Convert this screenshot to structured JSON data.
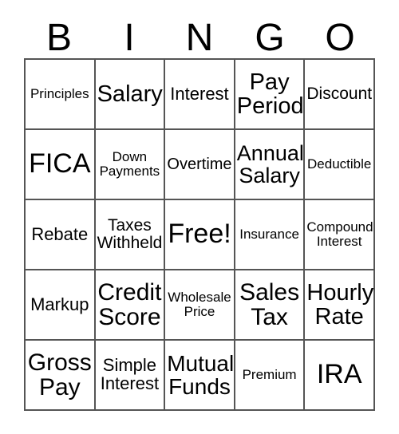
{
  "card": {
    "title_letters": [
      "B",
      "I",
      "N",
      "G",
      "O"
    ],
    "grid": {
      "columns": 5,
      "rows": 5,
      "border_color": "#555555",
      "background_color": "#ffffff",
      "text_color": "#000000"
    },
    "cells": [
      {
        "text": "Principles",
        "size": "sm",
        "row": 1,
        "col": 1
      },
      {
        "text": "Salary",
        "size": "xl",
        "row": 1,
        "col": 2
      },
      {
        "text": "Interest",
        "size": "md",
        "row": 1,
        "col": 3
      },
      {
        "text": "Pay Period",
        "size": "xl",
        "row": 1,
        "col": 4
      },
      {
        "text": "Discount",
        "size": "md",
        "row": 1,
        "col": 5
      },
      {
        "text": "FICA",
        "size": "xxl",
        "row": 2,
        "col": 1
      },
      {
        "text": "Down Payments",
        "size": "sm",
        "row": 2,
        "col": 2
      },
      {
        "text": "Overtime",
        "size": "md",
        "row": 2,
        "col": 3
      },
      {
        "text": "Annual Salary",
        "size": "lg",
        "row": 2,
        "col": 4
      },
      {
        "text": "Deductible",
        "size": "sm",
        "row": 2,
        "col": 5
      },
      {
        "text": "Rebate",
        "size": "md",
        "row": 3,
        "col": 1
      },
      {
        "text": "Taxes Withheld",
        "size": "md",
        "row": 3,
        "col": 2
      },
      {
        "text": "Free!",
        "size": "xxl",
        "row": 3,
        "col": 3
      },
      {
        "text": "Insurance",
        "size": "sm",
        "row": 3,
        "col": 4
      },
      {
        "text": "Compound Interest",
        "size": "sm",
        "row": 3,
        "col": 5
      },
      {
        "text": "Markup",
        "size": "md",
        "row": 4,
        "col": 1
      },
      {
        "text": "Credit Score",
        "size": "xl",
        "row": 4,
        "col": 2
      },
      {
        "text": "Wholesale Price",
        "size": "sm",
        "row": 4,
        "col": 3
      },
      {
        "text": "Sales Tax",
        "size": "xl",
        "row": 4,
        "col": 4
      },
      {
        "text": "Hourly Rate",
        "size": "xl",
        "row": 4,
        "col": 5
      },
      {
        "text": "Gross Pay",
        "size": "xl",
        "row": 5,
        "col": 1
      },
      {
        "text": "Simple Interest",
        "size": "md",
        "row": 5,
        "col": 2
      },
      {
        "text": "Mutual Funds",
        "size": "xl",
        "row": 5,
        "col": 3
      },
      {
        "text": "Premium",
        "size": "sm",
        "row": 5,
        "col": 4
      },
      {
        "text": "IRA",
        "size": "xxl",
        "row": 5,
        "col": 5
      }
    ]
  }
}
